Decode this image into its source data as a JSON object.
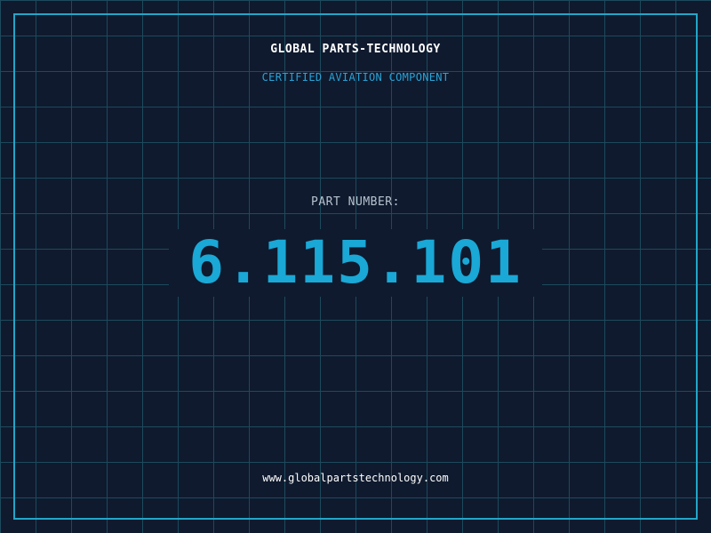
{
  "header": {
    "company": "GLOBAL PARTS-TECHNOLOGY",
    "subtitle": "CERTIFIED AVIATION COMPONENT"
  },
  "part": {
    "label": "PART NUMBER:",
    "number": "6.115.101"
  },
  "footer": {
    "website": "www.globalpartstechnology.com"
  },
  "colors": {
    "background": "#0f1a2e",
    "grid": "#1c4a5c",
    "accent": "#23a6c8",
    "part_number": "#1aa8d6"
  }
}
